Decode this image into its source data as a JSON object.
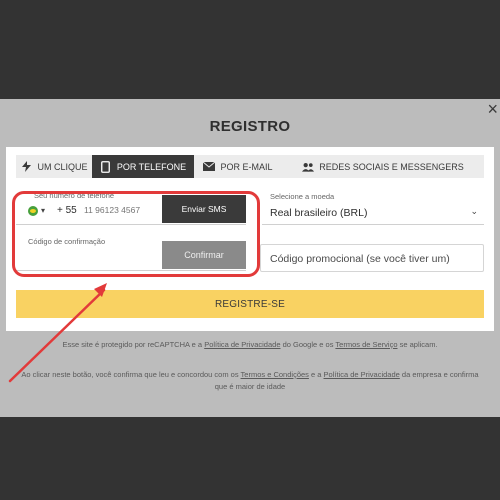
{
  "modal": {
    "title": "REGISTRO",
    "close_label": "×"
  },
  "tabs": [
    {
      "label": "UM CLIQUE",
      "icon": "lightning-icon",
      "active": false
    },
    {
      "label": "POR TELEFONE",
      "icon": "phone-icon",
      "active": true
    },
    {
      "label": "POR E-MAIL",
      "icon": "envelope-icon",
      "active": false
    },
    {
      "label": "REDES SOCIAIS E MESSENGERS",
      "icon": "users-icon",
      "active": false
    }
  ],
  "phone": {
    "label": "Seu número de telefone",
    "country_code": "+ 55",
    "placeholder": "11 96123 4567",
    "send_sms_label": "Enviar SMS"
  },
  "confirmation": {
    "label": "Código de confirmação",
    "confirm_label": "Confirmar"
  },
  "currency": {
    "label": "Selecione a moeda",
    "value": "Real brasileiro (BRL)"
  },
  "promo": {
    "placeholder": "Código promocional (se você tiver um)"
  },
  "register_label": "REGISTRE-SE",
  "legal": {
    "recaptcha_1": "Esse site é protegido por reCAPTCHA e a ",
    "recaptcha_link_1": "Política de Privacidade",
    "recaptcha_2": " do Google e os ",
    "recaptcha_link_2": "Termos de Serviço",
    "recaptcha_3": " se aplicam.",
    "consent_1": "Ao clicar neste botão, você confirma que leu e concordou com os ",
    "consent_link_1": "Termos e Condições",
    "consent_2": " e a ",
    "consent_link_2": "Política de Privacidade",
    "consent_3": " da empresa e confirma que é maior de idade"
  },
  "colors": {
    "accent_yellow": "#f9d262",
    "tab_active": "#3a3a3a",
    "annotation_red": "#e23a3a"
  }
}
